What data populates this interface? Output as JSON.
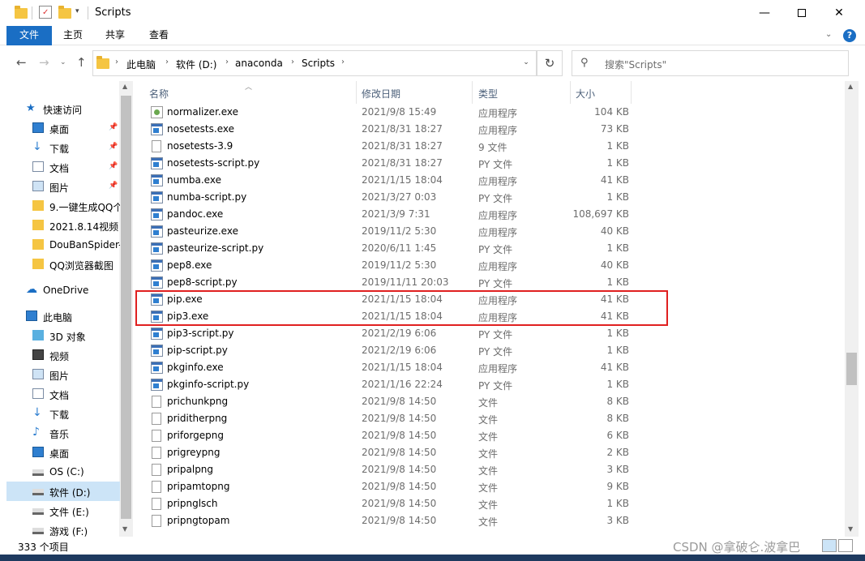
{
  "window": {
    "title": "Scripts"
  },
  "ribbon": {
    "tabs": [
      "文件",
      "主页",
      "共享",
      "查看"
    ]
  },
  "address": {
    "crumbs": [
      "此电脑",
      "软件 (D:)",
      "anaconda",
      "Scripts"
    ],
    "search_placeholder": "搜索\"Scripts\""
  },
  "sidebar": {
    "items": [
      {
        "label": "快速访问",
        "icon": "star-icon",
        "pinned": false
      },
      {
        "label": "桌面",
        "icon": "desktop-icon",
        "pinned": true
      },
      {
        "label": "下载",
        "icon": "download-icon",
        "pinned": true
      },
      {
        "label": "文档",
        "icon": "document-icon",
        "pinned": true
      },
      {
        "label": "图片",
        "icon": "picture-icon",
        "pinned": true
      },
      {
        "label": "9.一键生成QQ个",
        "icon": "folder-icon",
        "pinned": false
      },
      {
        "label": "2021.8.14视频",
        "icon": "folder-icon",
        "pinned": false
      },
      {
        "label": "DouBanSpider-",
        "icon": "folder-icon",
        "pinned": false
      },
      {
        "label": "QQ浏览器截图",
        "icon": "folder-icon",
        "pinned": false
      },
      {
        "label": "OneDrive",
        "icon": "cloud-icon",
        "pinned": false
      },
      {
        "label": "此电脑",
        "icon": "computer-icon",
        "pinned": false
      },
      {
        "label": "3D 对象",
        "icon": "cube-icon",
        "pinned": false
      },
      {
        "label": "视频",
        "icon": "video-icon",
        "pinned": false
      },
      {
        "label": "图片",
        "icon": "picture-icon",
        "pinned": false
      },
      {
        "label": "文档",
        "icon": "document-icon",
        "pinned": false
      },
      {
        "label": "下载",
        "icon": "download-icon",
        "pinned": false
      },
      {
        "label": "音乐",
        "icon": "music-icon",
        "pinned": false
      },
      {
        "label": "桌面",
        "icon": "desktop-icon",
        "pinned": false
      },
      {
        "label": "OS (C:)",
        "icon": "drive-icon",
        "pinned": false
      },
      {
        "label": "软件 (D:)",
        "icon": "drive-icon",
        "pinned": false,
        "selected": true
      },
      {
        "label": "文件 (E:)",
        "icon": "drive-icon",
        "pinned": false
      },
      {
        "label": "游戏 (F:)",
        "icon": "drive-icon",
        "pinned": false
      }
    ]
  },
  "columns": {
    "name": "名称",
    "date": "修改日期",
    "type": "类型",
    "size": "大小"
  },
  "files": [
    {
      "name": "normalizer.exe",
      "date": "2021/9/8 15:49",
      "type": "应用程序",
      "size": "104 KB",
      "icon": "norm"
    },
    {
      "name": "nosetests.exe",
      "date": "2021/8/31 18:27",
      "type": "应用程序",
      "size": "73 KB",
      "icon": "exe"
    },
    {
      "name": "nosetests-3.9",
      "date": "2021/8/31 18:27",
      "type": "9 文件",
      "size": "1 KB",
      "icon": "doc"
    },
    {
      "name": "nosetests-script.py",
      "date": "2021/8/31 18:27",
      "type": "PY 文件",
      "size": "1 KB",
      "icon": "py"
    },
    {
      "name": "numba.exe",
      "date": "2021/1/15 18:04",
      "type": "应用程序",
      "size": "41 KB",
      "icon": "exe"
    },
    {
      "name": "numba-script.py",
      "date": "2021/3/27 0:03",
      "type": "PY 文件",
      "size": "1 KB",
      "icon": "py"
    },
    {
      "name": "pandoc.exe",
      "date": "2021/3/9 7:31",
      "type": "应用程序",
      "size": "108,697 KB",
      "icon": "exe"
    },
    {
      "name": "pasteurize.exe",
      "date": "2019/11/2 5:30",
      "type": "应用程序",
      "size": "40 KB",
      "icon": "exe"
    },
    {
      "name": "pasteurize-script.py",
      "date": "2020/6/11 1:45",
      "type": "PY 文件",
      "size": "1 KB",
      "icon": "py"
    },
    {
      "name": "pep8.exe",
      "date": "2019/11/2 5:30",
      "type": "应用程序",
      "size": "40 KB",
      "icon": "exe"
    },
    {
      "name": "pep8-script.py",
      "date": "2019/11/11 20:03",
      "type": "PY 文件",
      "size": "1 KB",
      "icon": "py"
    },
    {
      "name": "pip.exe",
      "date": "2021/1/15 18:04",
      "type": "应用程序",
      "size": "41 KB",
      "icon": "exe"
    },
    {
      "name": "pip3.exe",
      "date": "2021/1/15 18:04",
      "type": "应用程序",
      "size": "41 KB",
      "icon": "exe"
    },
    {
      "name": "pip3-script.py",
      "date": "2021/2/19 6:06",
      "type": "PY 文件",
      "size": "1 KB",
      "icon": "py"
    },
    {
      "name": "pip-script.py",
      "date": "2021/2/19 6:06",
      "type": "PY 文件",
      "size": "1 KB",
      "icon": "py"
    },
    {
      "name": "pkginfo.exe",
      "date": "2021/1/15 18:04",
      "type": "应用程序",
      "size": "41 KB",
      "icon": "exe"
    },
    {
      "name": "pkginfo-script.py",
      "date": "2021/1/16 22:24",
      "type": "PY 文件",
      "size": "1 KB",
      "icon": "py"
    },
    {
      "name": "prichunkpng",
      "date": "2021/9/8 14:50",
      "type": "文件",
      "size": "8 KB",
      "icon": "doc"
    },
    {
      "name": "priditherpng",
      "date": "2021/9/8 14:50",
      "type": "文件",
      "size": "8 KB",
      "icon": "doc"
    },
    {
      "name": "priforgepng",
      "date": "2021/9/8 14:50",
      "type": "文件",
      "size": "6 KB",
      "icon": "doc"
    },
    {
      "name": "prigreypng",
      "date": "2021/9/8 14:50",
      "type": "文件",
      "size": "2 KB",
      "icon": "doc"
    },
    {
      "name": "pripalpng",
      "date": "2021/9/8 14:50",
      "type": "文件",
      "size": "3 KB",
      "icon": "doc"
    },
    {
      "name": "pripamtopng",
      "date": "2021/9/8 14:50",
      "type": "文件",
      "size": "9 KB",
      "icon": "doc"
    },
    {
      "name": "pripnglsch",
      "date": "2021/9/8 14:50",
      "type": "文件",
      "size": "1 KB",
      "icon": "doc"
    },
    {
      "name": "pripngtopam",
      "date": "2021/9/8 14:50",
      "type": "文件",
      "size": "3 KB",
      "icon": "doc"
    }
  ],
  "status": {
    "count": "333 个项目"
  },
  "watermark": "CSDN @拿破仑.波拿巴"
}
